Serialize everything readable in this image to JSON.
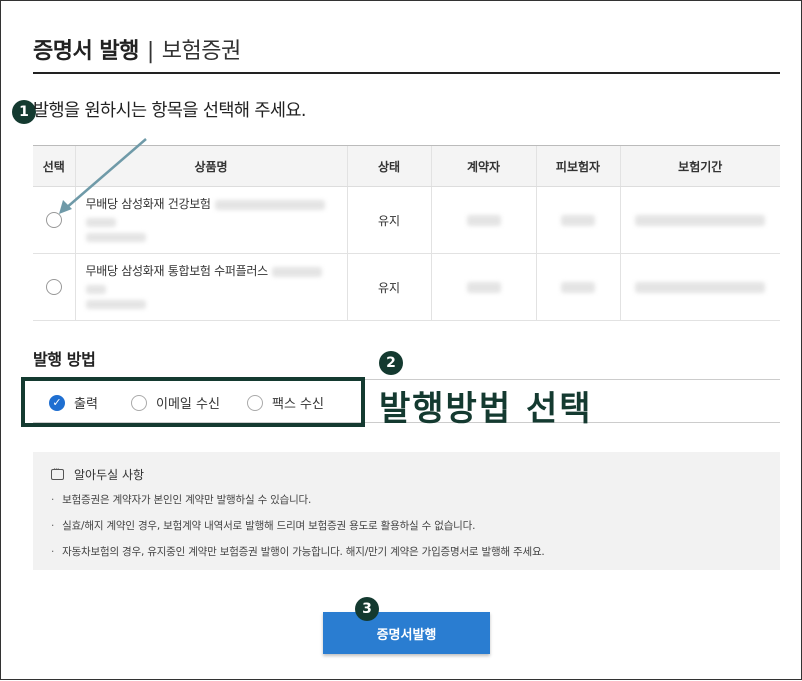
{
  "header": {
    "title": "증명서 발행",
    "separator": "|",
    "subtitle": "보험증권"
  },
  "steps": {
    "one": "1",
    "two": "2",
    "three": "3"
  },
  "instruction": "발행을 원하시는 항목을 선택해 주세요.",
  "table": {
    "headers": [
      "선택",
      "상품명",
      "상태",
      "계약자",
      "피보험자",
      "보험기간"
    ],
    "rows": [
      {
        "product": "무배당 삼성화재 건강보험",
        "status": "유지"
      },
      {
        "product": "무배당 삼성화재 통합보험 수퍼플러스",
        "status": "유지"
      }
    ]
  },
  "method": {
    "title": "발행 방법",
    "options": [
      {
        "label": "출력",
        "selected": true
      },
      {
        "label": "이메일 수신",
        "selected": false
      },
      {
        "label": "팩스 수신",
        "selected": false
      }
    ],
    "callout": "발행방법 선택"
  },
  "notice": {
    "title": "알아두실 사항",
    "items": [
      "보험증권은 계약자가 본인인 계약만 발행하실 수 있습니다.",
      "실효/해지 계약인 경우, 보험계약 내역서로 발행해 드리며 보험증권 용도로 활용하실 수 없습니다.",
      "자동차보험의 경우, 유지중인 계약만 보험증권 발행이 가능합니다. 해지/만기 계약은 가입증명서로 발행해 주세요."
    ]
  },
  "issue_button": "증명서발행",
  "colors": {
    "accent": "#2a7dd1",
    "annotation": "#143a30",
    "arrow": "#6f9aa8"
  },
  "icons": {
    "check": "check-icon",
    "notice": "chat-bubble-icon"
  }
}
